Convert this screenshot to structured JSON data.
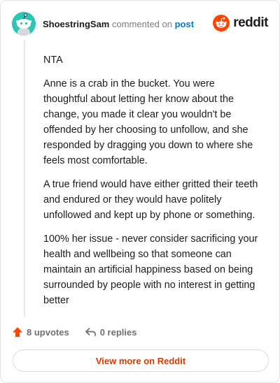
{
  "header": {
    "author": "ShoestringSam",
    "action_text": "commented on",
    "post_link": "post",
    "brand": "reddit"
  },
  "comment": {
    "paragraphs": [
      "NTA",
      "Anne is a crab in the bucket. You were thoughtful about letting her know about the change, you made it clear you wouldn't be offended by her choosing to unfollow, and she responded by dragging you down to where she feels most comfortable.",
      "A true friend would have either gritted their teeth and endured or they would have politely unfollowed and kept up by phone or something.",
      "100% her issue - never consider sacrificing your health and wellbeing so that someone can maintain an artificial happiness based on being surrounded by people with no interest in getting better"
    ]
  },
  "actions": {
    "upvotes": "8 upvotes",
    "replies": "0 replies"
  },
  "footer": {
    "view_more": "View more on Reddit"
  },
  "colors": {
    "brand_orange": "#ff4500",
    "link_blue": "#0079d3",
    "avatar_teal": "#2ec4b6",
    "view_more_text": "#d93a00"
  },
  "icons": [
    "snoo-avatar-icon",
    "reddit-logo-icon",
    "upvote-arrow-icon",
    "reply-arrow-icon"
  ]
}
